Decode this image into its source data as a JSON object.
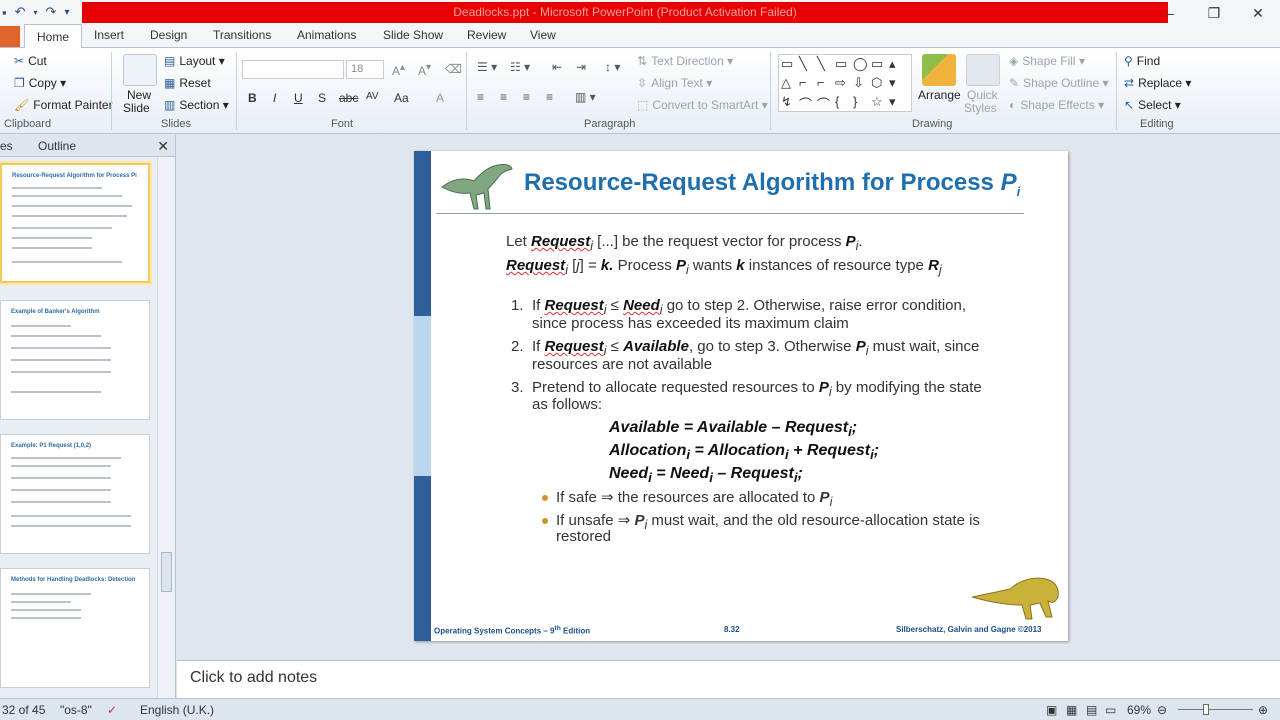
{
  "window": {
    "title": "Deadlocks.ppt - Microsoft PowerPoint (Product Activation Failed)",
    "controls": [
      "–",
      "❐",
      "✕"
    ]
  },
  "qat": [
    "undo",
    "undo",
    "redo",
    "customize"
  ],
  "tabs": {
    "file": "",
    "items": [
      "Home",
      "Insert",
      "Design",
      "Transitions",
      "Animations",
      "Slide Show",
      "Review",
      "View"
    ]
  },
  "ribbon": {
    "clipboard": {
      "cut": "Cut",
      "copy": "Copy",
      "format_painter": "Format Painter",
      "label": "Clipboard"
    },
    "slides": {
      "new_slide": "New",
      "new_slide2": "Slide",
      "layout": "Layout",
      "reset": "Reset",
      "section": "Section",
      "label": "Slides"
    },
    "font": {
      "size": "18",
      "label": "Font",
      "b": "B",
      "i": "I",
      "u": "U",
      "s": "S",
      "abc": "abc",
      "av": "AV",
      "aa": "Aa",
      "a": "A"
    },
    "paragraph": {
      "text_direction": "Text Direction",
      "align_text": "Align Text",
      "smartart": "Convert to SmartArt",
      "label": "Paragraph"
    },
    "drawing": {
      "arrange": "Arrange",
      "quick_styles": "Quick",
      "quick_styles2": "Styles",
      "shape_fill": "Shape Fill",
      "shape_outline": "Shape Outline",
      "shape_effects": "Shape Effects",
      "label": "Drawing"
    },
    "editing": {
      "find": "Find",
      "replace": "Replace",
      "select": "Select",
      "label": "Editing"
    }
  },
  "left_pane": {
    "tab_slides": "es",
    "tab_outline": "Outline",
    "close": "✕",
    "thumbs": [
      {
        "title": "Resource-Request Algorithm for Process Pi"
      },
      {
        "title": "Example of Banker's Algorithm"
      },
      {
        "title": "Example: P1 Request (1,0,2)"
      },
      {
        "title": "Methods for Handling Deadlocks: Detection"
      }
    ]
  },
  "slide": {
    "title_main": "Resource-Request Algorithm for Process ",
    "title_p": "P",
    "title_sub": "i",
    "line1_a": "Let ",
    "line1_b": "Request",
    "line1_c": "i",
    "line1_d": " [...] be the request vector for process ",
    "line1_e": "P",
    "line1_f": "i",
    "line1_g": ".",
    "line2_a": "Request",
    "line2_b": "i",
    "line2_c": " [",
    "line2_d": "j",
    "line2_e": "] = ",
    "line2_f": "k.",
    "line2_g": " Process ",
    "line2_h": "P",
    "line2_i": "i",
    "line2_j": " wants ",
    "line2_k": "k",
    "line2_l": " instances of resource type ",
    "line2_m": "R",
    "line2_n": "j",
    "item1_num": "1.",
    "item1_a": "If ",
    "item1_b": "Request",
    "item1_c": "i",
    "item1_d": " ≤ ",
    "item1_e": "Need",
    "item1_f": "i",
    "item1_g": "  go to step 2.  Otherwise, raise error condition,",
    "item1_h": "since process has exceeded its maximum claim",
    "item2_num": "2.",
    "item2_a": "If ",
    "item2_b": "Request",
    "item2_c": "i",
    "item2_d": " ≤ ",
    "item2_e": "Available",
    "item2_f": ",  go to step 3.  Otherwise ",
    "item2_g": "P",
    "item2_h": "i",
    "item2_i": "  must wait, since",
    "item2_j": "resources are not available",
    "item3_num": "3.",
    "item3_a": "Pretend to allocate requested resources to ",
    "item3_b": "P",
    "item3_c": "i",
    "item3_d": " by modifying the state",
    "item3_e": "as follows:",
    "eq1": "Available = Available  – Request",
    "eq1_sub": "i",
    "eq1_end": ";",
    "eq2": "Allocation",
    "eq2_sub1": "i",
    "eq2_mid": " = Allocation",
    "eq2_sub2": "i",
    "eq2_plus": " + Request",
    "eq2_sub3": "i",
    "eq2_end": ";",
    "eq3": "Need",
    "eq3_sub1": "i",
    "eq3_mid": " = Need",
    "eq3_sub2": "i",
    "eq3_minus": " – Request",
    "eq3_sub3": "i",
    "eq3_end": ";",
    "b1_a": "If safe ⇒ the resources are allocated to ",
    "b1_b": "P",
    "b1_c": "i",
    "b2_a": "If unsafe ⇒ ",
    "b2_b": "P",
    "b2_c": "i",
    "b2_d": " must wait, and the old resource-allocation state is",
    "b2_e": "restored",
    "footer_left": "Operating System Concepts – 9",
    "footer_left_sup": "th",
    "footer_left_end": " Edition",
    "footer_mid": "8.32",
    "footer_right": "Silberschatz, Galvin and Gagne ©2013"
  },
  "notes": {
    "placeholder": "Click to add notes"
  },
  "status": {
    "slide_count": "32 of 45",
    "theme": "\"os-8\"",
    "language": "English (U.K.)",
    "zoom": "69%"
  },
  "colors": {
    "title_blue": "#1f6fae",
    "sidebar_blue": "#2f5f98",
    "red_title": "#e60000"
  }
}
